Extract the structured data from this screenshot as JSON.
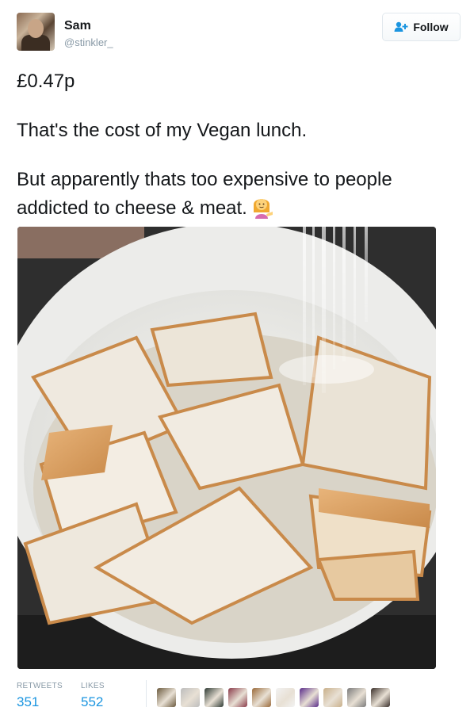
{
  "user": {
    "name": "Sam",
    "handle": "@stinkler_"
  },
  "follow_button": {
    "label": "Follow"
  },
  "tweet": {
    "line1": "£0.47p",
    "line2": "That's the cost of my Vegan lunch.",
    "line3": "But apparently thats too expensive to people addicted to cheese & meat."
  },
  "stats": {
    "retweets_label": "RETWEETS",
    "retweets_value": "351",
    "likes_label": "LIKES",
    "likes_value": "552"
  },
  "likers": [
    {
      "color": "#6b5a3e"
    },
    {
      "color": "#bdbdbd"
    },
    {
      "color": "#2f3b35"
    },
    {
      "color": "#8a3b4a"
    },
    {
      "color": "#9a6a3a"
    },
    {
      "color": "#f2f2f2"
    },
    {
      "color": "#5a2c8a"
    },
    {
      "color": "#c9b08a"
    },
    {
      "color": "#7a7a7a"
    },
    {
      "color": "#3a2f2a"
    }
  ],
  "colors": {
    "link": "#1b95e0",
    "muted": "#8899a6",
    "border": "#e1e8ed"
  }
}
